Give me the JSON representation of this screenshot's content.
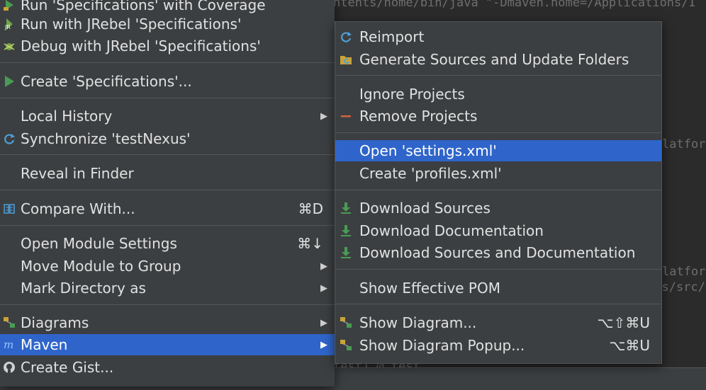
{
  "console": {
    "lines": [
      "ntents/home/bin/java \"-Dmaven.home=/Applications/I",
      "latform",
      "latform",
      "roject/testNexus/src/test,",
      "test) @ test"
    ]
  },
  "left_menu": {
    "items": [
      {
        "label": "Run 'Specifications' with Coverage",
        "icon": "coverage-icon"
      },
      {
        "label": "Run with JRebel 'Specifications'",
        "icon": "jrebel-run-icon"
      },
      {
        "label": "Debug with JRebel 'Specifications'",
        "icon": "jrebel-debug-icon"
      },
      {
        "label": "Create 'Specifications'...",
        "icon": "run-triangle-icon"
      },
      {
        "label": "Local History",
        "icon": ""
      },
      {
        "label": "Synchronize 'testNexus'",
        "icon": "sync-icon"
      },
      {
        "label": "Reveal in Finder",
        "icon": ""
      },
      {
        "label": "Compare With...",
        "icon": "compare-icon",
        "shortcut": "⌘D"
      },
      {
        "label": "Open Module Settings",
        "icon": "",
        "shortcut": "⌘↓"
      },
      {
        "label": "Move Module to Group",
        "icon": ""
      },
      {
        "label": "Mark Directory as",
        "icon": ""
      },
      {
        "label": "Diagrams",
        "icon": "diagram-icon"
      },
      {
        "label": "Maven",
        "icon": "maven-icon"
      },
      {
        "label": "Create Gist...",
        "icon": "github-icon"
      }
    ]
  },
  "right_menu": {
    "items": [
      {
        "label": "Reimport",
        "icon": "reimport-icon"
      },
      {
        "label": "Generate Sources and Update Folders",
        "icon": "generate-icon"
      },
      {
        "label": "Ignore Projects",
        "icon": ""
      },
      {
        "label": "Remove Projects",
        "icon": "remove-icon"
      },
      {
        "label": "Open 'settings.xml'",
        "icon": ""
      },
      {
        "label": "Create 'profiles.xml'",
        "icon": ""
      },
      {
        "label": "Download Sources",
        "icon": "download-icon"
      },
      {
        "label": "Download Documentation",
        "icon": "download-icon"
      },
      {
        "label": "Download Sources and Documentation",
        "icon": "download-icon"
      },
      {
        "label": "Show Effective POM",
        "icon": ""
      },
      {
        "label": "Show Diagram...",
        "icon": "diagram-icon",
        "shortcut": "⌥⇧⌘U"
      },
      {
        "label": "Show Diagram Popup...",
        "icon": "diagram-icon",
        "shortcut": "⌥⌘U"
      }
    ]
  },
  "colors": {
    "menu_bg": "#3c3f41",
    "selection": "#2f65ca",
    "text": "#e1e1e1",
    "separator": "#555555"
  }
}
